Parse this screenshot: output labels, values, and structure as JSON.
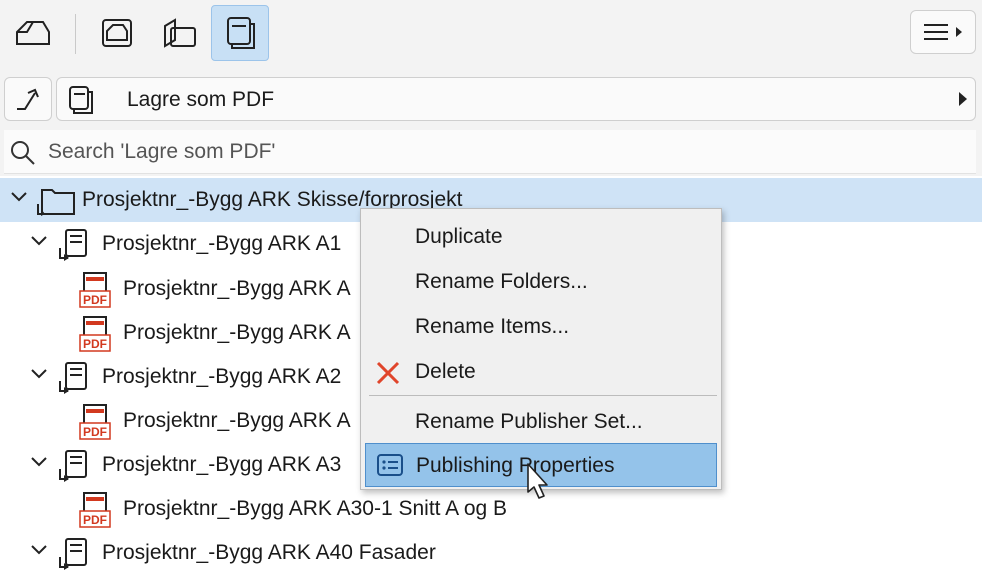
{
  "toolbar": {
    "buttons": [
      {
        "icon": "project-map-icon",
        "active": false
      },
      {
        "icon": "view-map-icon",
        "active": false
      },
      {
        "icon": "layout-book-icon",
        "active": false
      },
      {
        "icon": "publisher-sets-icon",
        "active": true
      }
    ],
    "menu_icon": "hamburger-menu-icon"
  },
  "path": {
    "up_icon": "go-up-icon",
    "icon": "publisher-sets-icon",
    "label": "Lagre som PDF"
  },
  "search": {
    "icon": "search-icon",
    "placeholder": "Search 'Lagre som PDF'"
  },
  "tree": {
    "rows": [
      {
        "label": "Prosjektnr_-Bygg ARK  Skisse/forprosjekt",
        "type": "folder",
        "expanded": true,
        "selected": true
      },
      {
        "label": "Prosjektnr_-Bygg ARK A1",
        "type": "subset",
        "expanded": true
      },
      {
        "label": "Prosjektnr_-Bygg ARK A",
        "type": "pdf"
      },
      {
        "label": "Prosjektnr_-Bygg ARK A",
        "type": "pdf"
      },
      {
        "label": "Prosjektnr_-Bygg ARK A2",
        "type": "subset",
        "expanded": true
      },
      {
        "label": "Prosjektnr_-Bygg ARK A",
        "type": "pdf"
      },
      {
        "label": "Prosjektnr_-Bygg ARK A3",
        "type": "subset",
        "expanded": true
      },
      {
        "label": "Prosjektnr_-Bygg ARK A30-1 Snitt A og B",
        "type": "pdf"
      },
      {
        "label": "Prosjektnr_-Bygg ARK A40 Fasader",
        "type": "subset",
        "expanded": true
      }
    ],
    "pdf_badge": "PDF"
  },
  "context_menu": {
    "items": [
      {
        "label": "Duplicate"
      },
      {
        "label": "Rename Folders..."
      },
      {
        "label": "Rename Items..."
      },
      {
        "label": "Delete",
        "icon": "delete-x-icon",
        "icon_color": "#e0452b"
      },
      {
        "label": "Rename Publisher Set..."
      },
      {
        "label": "Publishing Properties",
        "icon": "properties-icon",
        "highlighted": true
      }
    ]
  },
  "colors": {
    "selection": "#cfe3f6",
    "toolbar_active": "#c8e0f5",
    "menu_highlight": "#94c3ea",
    "pdf_red": "#d2391f"
  }
}
